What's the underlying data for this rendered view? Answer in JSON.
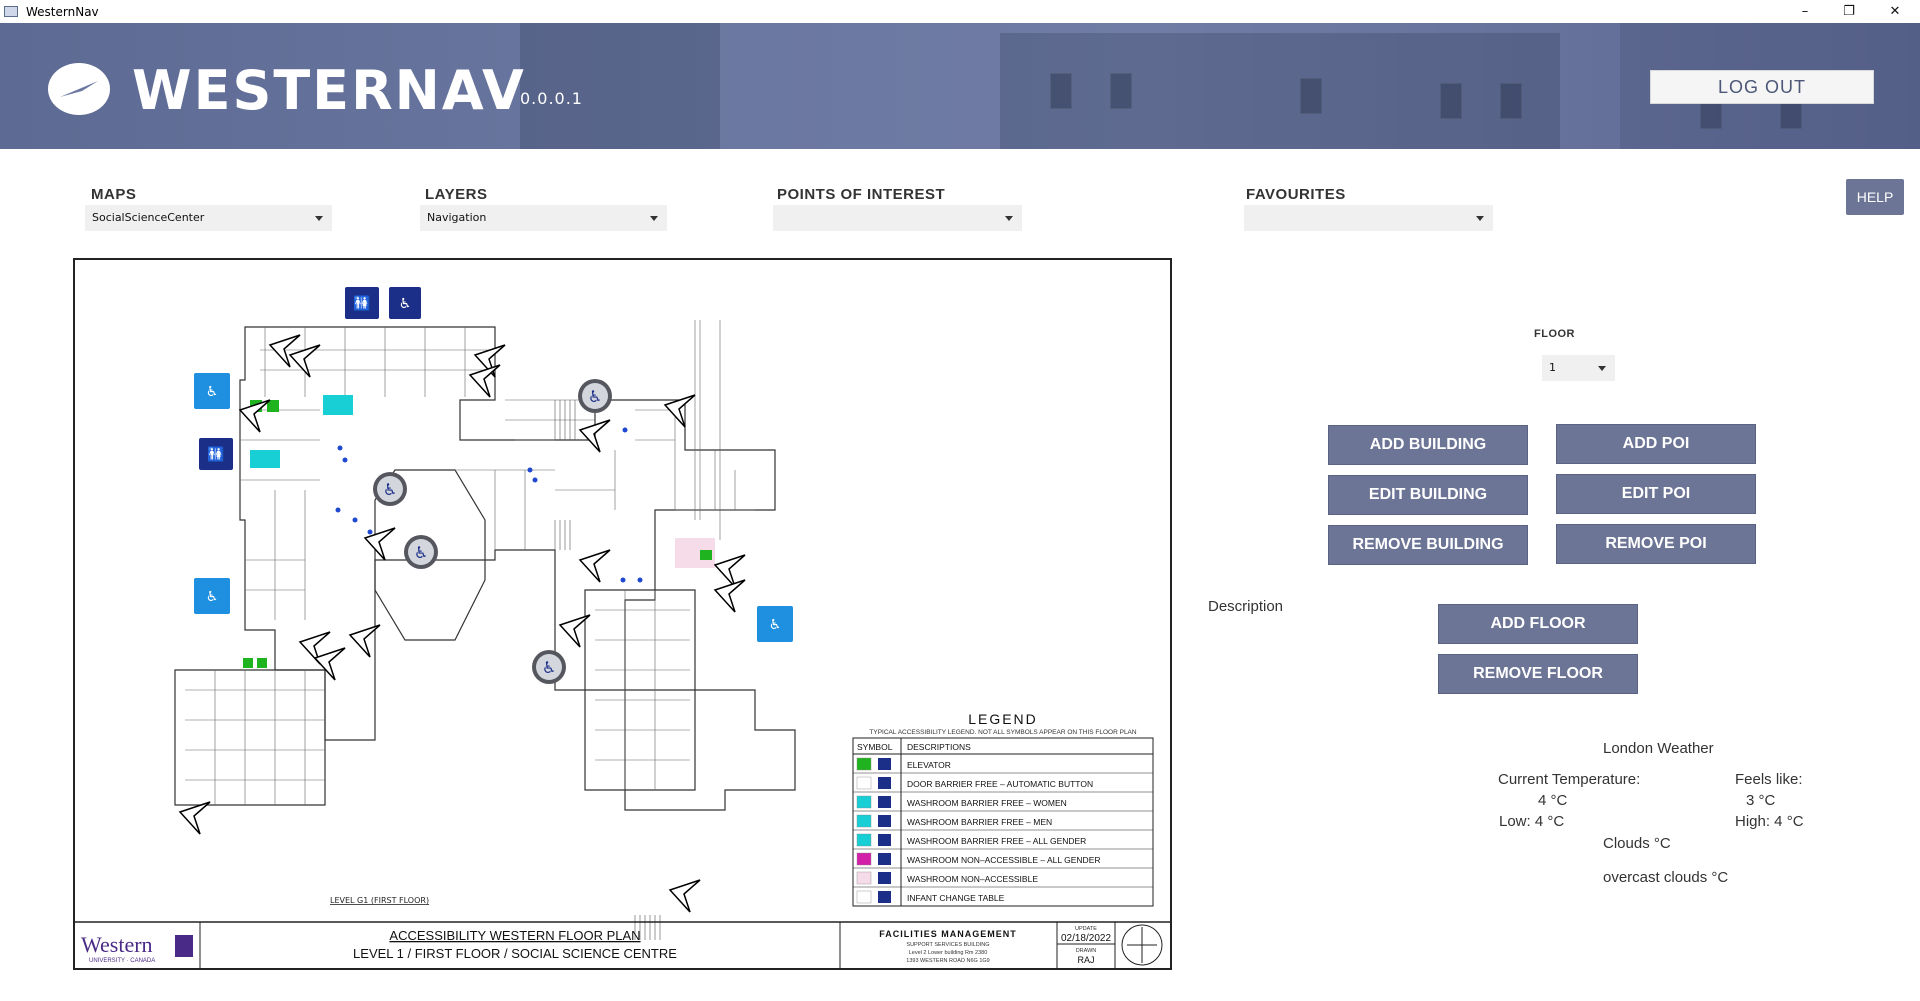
{
  "window": {
    "title": "WesternNav",
    "controls": {
      "minimize": "–",
      "restore": "❐",
      "close": "✕"
    }
  },
  "banner": {
    "brand": "WESTERNAV",
    "version": "0.0.0.1",
    "logout_label": "LOG OUT",
    "logo_icon": "compass-icon"
  },
  "selectors": {
    "maps": {
      "label": "MAPS",
      "value": "SocialScienceCenter"
    },
    "layers": {
      "label": "LAYERS",
      "value": "Navigation"
    },
    "poi": {
      "label": "POINTS OF INTEREST",
      "value": ""
    },
    "favourites": {
      "label": "FAVOURITES",
      "value": ""
    },
    "help_label": "HELP"
  },
  "map": {
    "legend": {
      "title": "LEGEND",
      "subtitle": "TYPICAL ACCESSIBILITY LEGEND. NOT ALL SYMBOLS APPEAR ON THIS FLOOR PLAN",
      "header_symbol": "SYMBOL",
      "header_desc": "DESCRIPTIONS",
      "rows": [
        {
          "color": "#1fb31f",
          "desc": "ELEVATOR"
        },
        {
          "color": "#ffffff",
          "desc": "DOOR BARRIER FREE – AUTOMATIC BUTTON"
        },
        {
          "color": "#19cfd6",
          "desc": "WASHROOM BARRIER FREE – WOMEN"
        },
        {
          "color": "#19cfd6",
          "desc": "WASHROOM BARRIER FREE – MEN"
        },
        {
          "color": "#19cfd6",
          "desc": "WASHROOM BARRIER FREE    – ALL GENDER"
        },
        {
          "color": "#d21fa8",
          "desc": "WASHROOM NON–ACCESSIBLE  – ALL GENDER"
        },
        {
          "color": "#f6dce8",
          "desc": "WASHROOM NON–ACCESSIBLE"
        },
        {
          "color": "#ffffff",
          "desc": "INFANT CHANGE TABLE"
        }
      ]
    },
    "level_label": "LEVEL G1 (FIRST FLOOR)",
    "title_block": {
      "university": "Western",
      "university_sub": "UNIVERSITY · CANADA",
      "plan_title": "ACCESSIBILITY WESTERN FLOOR PLAN",
      "plan_subtitle": "LEVEL 1 / FIRST FLOOR / SOCIAL SCIENCE CENTRE",
      "dept": "FACILITIES MANAGEMENT",
      "dept_line1": "SUPPORT SERVICES BUILDING",
      "dept_line2": "Level 2  Lower building  Rm 2380",
      "dept_line3": "1393 WESTERN ROAD   N6G 1G9",
      "update_label": "UPDATE",
      "update_date": "02/18/2022",
      "drawn_label": "DRAWN",
      "drawn_by": "RAJ"
    }
  },
  "panel": {
    "floor_label": "FLOOR",
    "floor_value": "1",
    "buttons": {
      "add_building": "ADD BUILDING",
      "edit_building": "EDIT BUILDING",
      "remove_building": "REMOVE BUILDING",
      "add_poi": "ADD POI",
      "edit_poi": "EDIT POI",
      "remove_poi": "REMOVE POI",
      "add_floor": "ADD FLOOR",
      "remove_floor": "REMOVE FLOOR"
    },
    "description_label": "Description"
  },
  "weather": {
    "title": "London Weather",
    "current_label": "Current Temperature:",
    "current_value": "4 °C",
    "feels_label": "Feels like:",
    "feels_value": "3 °C",
    "low": "Low: 4 °C",
    "high": "High:  4 °C",
    "clouds": "Clouds °C",
    "desc": "overcast clouds °C"
  }
}
